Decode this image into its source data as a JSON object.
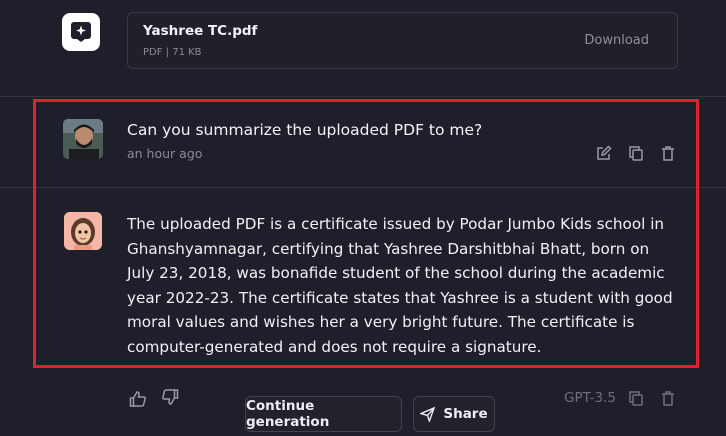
{
  "file": {
    "name": "Yashree TC.pdf",
    "meta": "PDF | 71 KB",
    "download_label": "Download"
  },
  "user_message": {
    "text": "Can you summarize the uploaded PDF to me?",
    "time": "an hour ago"
  },
  "assistant_message": {
    "text": "The uploaded PDF is a certificate issued by Podar Jumbo Kids school in Ghanshyamnagar, certifying that Yashree Darshitbhai Bhatt, born on July 23, 2018, was bonafide student of the school during the academic year 2022-23. The certificate states that Yashree is a student with good moral values and wishes her a very bright future. The certificate is computer-generated and does not require a signature."
  },
  "actions": {
    "continue_label": "Continue generation",
    "share_label": "Share",
    "model": "GPT-3.5"
  },
  "colors": {
    "background": "#1f1f2b",
    "highlight": "#e0222e",
    "card_border": "#3a3a46"
  }
}
